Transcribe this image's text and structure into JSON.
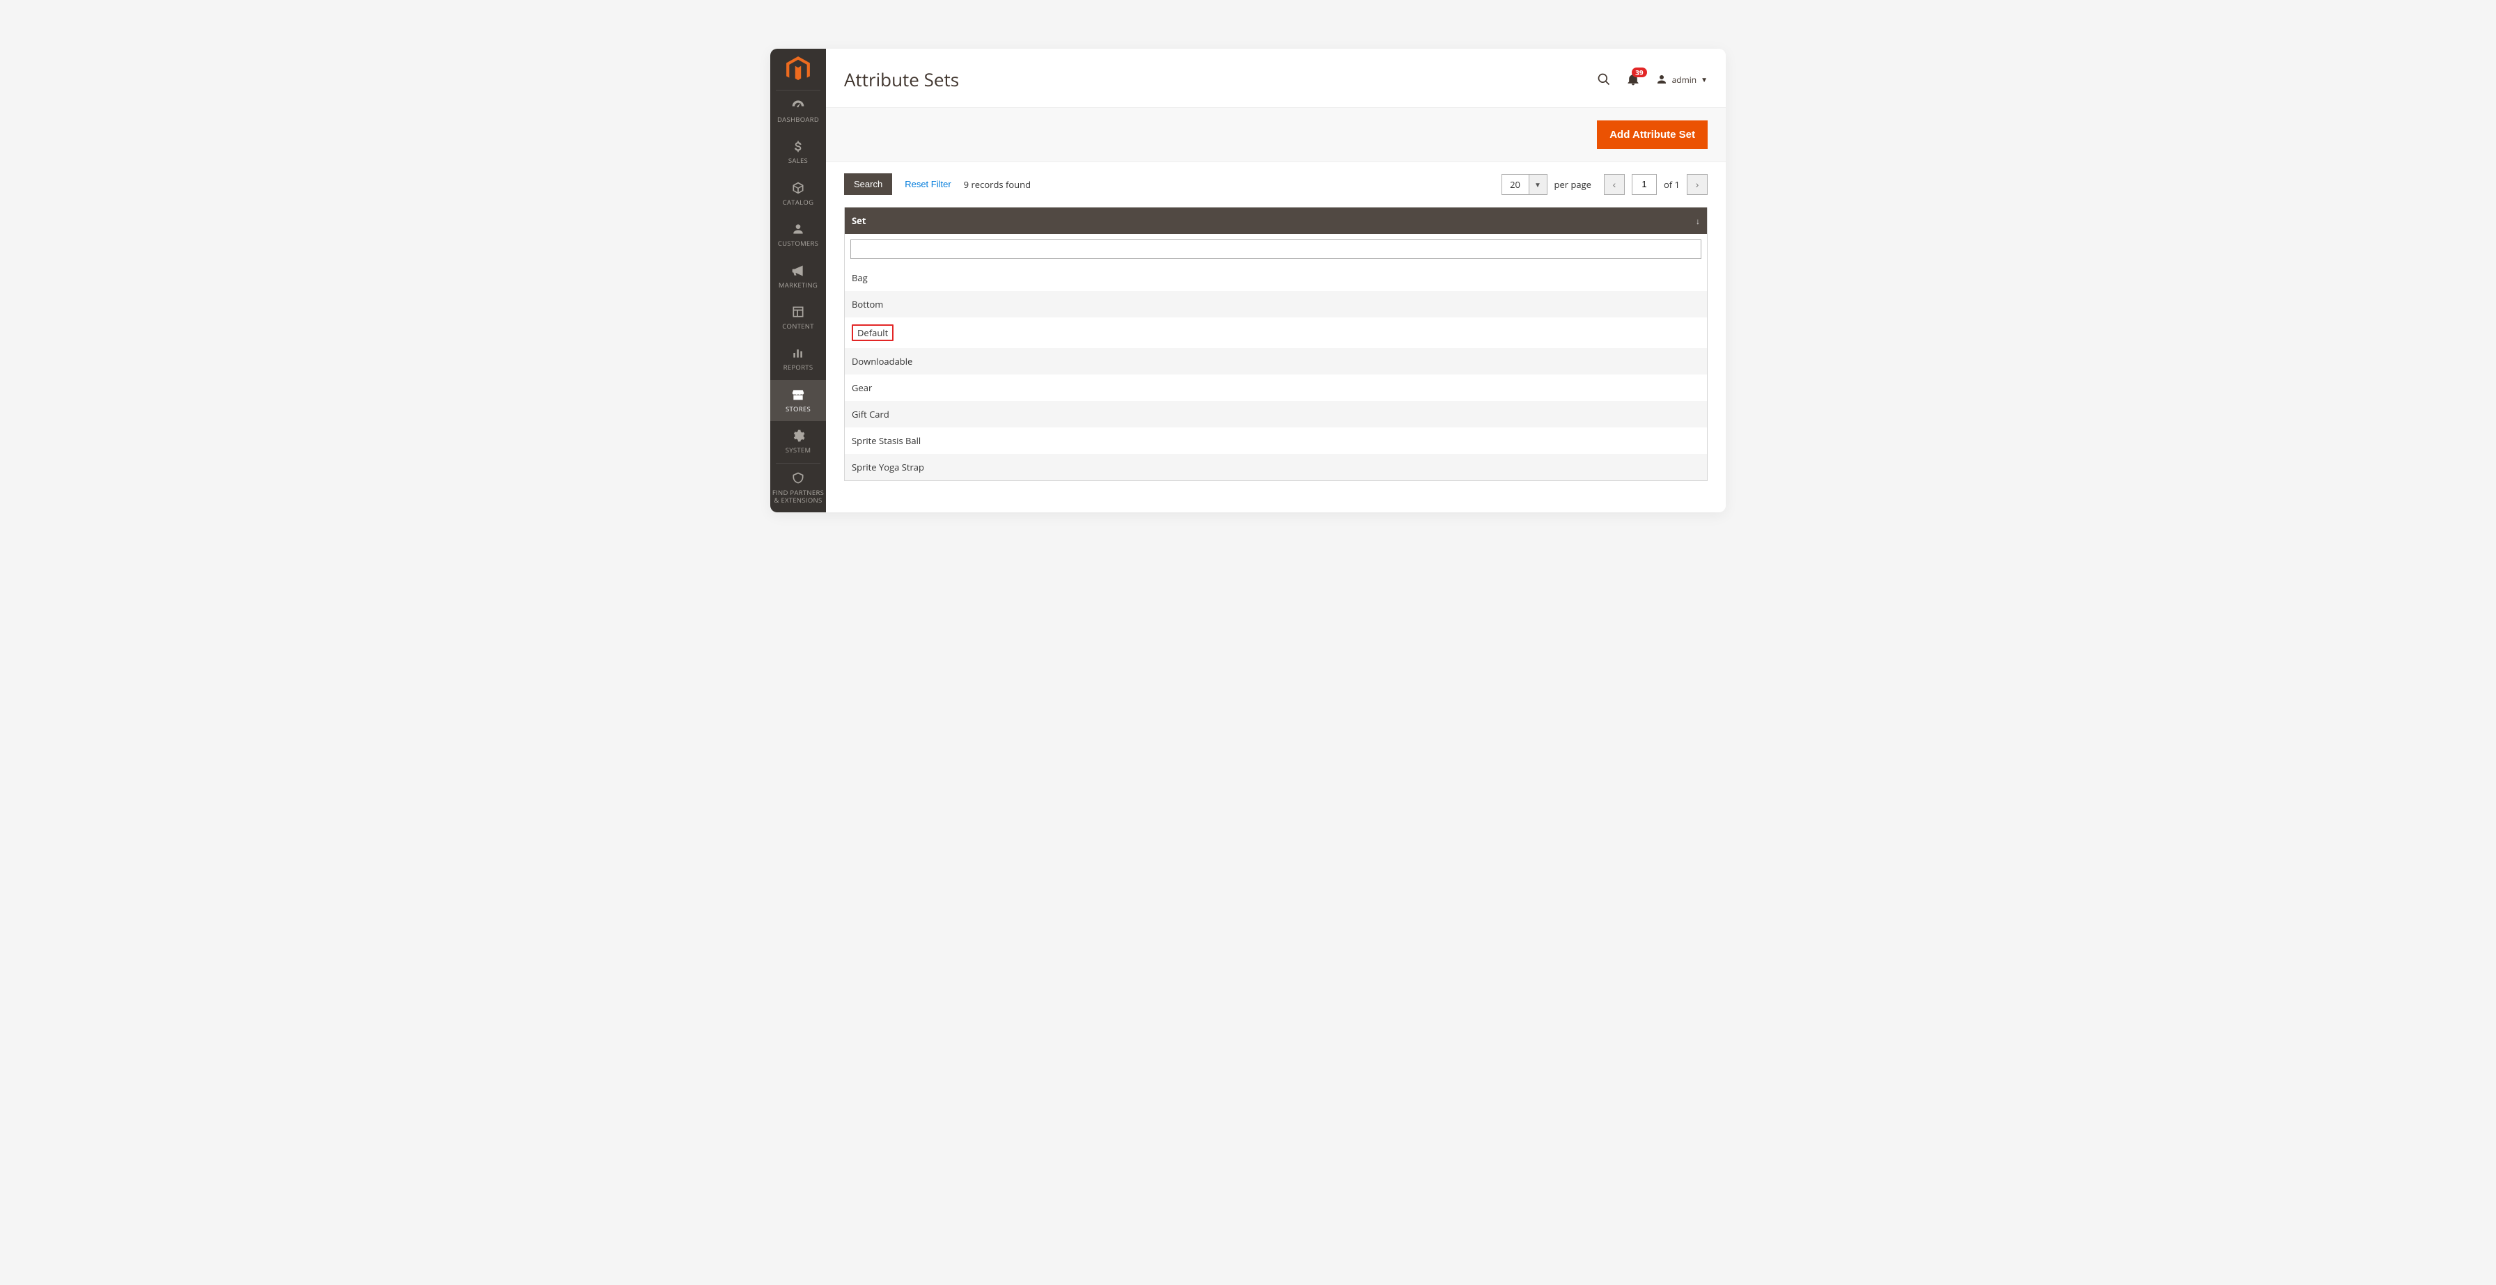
{
  "sidebar": {
    "items": [
      {
        "label": "DASHBOARD"
      },
      {
        "label": "SALES"
      },
      {
        "label": "CATALOG"
      },
      {
        "label": "CUSTOMERS"
      },
      {
        "label": "MARKETING"
      },
      {
        "label": "CONTENT"
      },
      {
        "label": "REPORTS"
      },
      {
        "label": "STORES"
      },
      {
        "label": "SYSTEM"
      },
      {
        "label": "FIND PARTNERS & EXTENSIONS"
      }
    ]
  },
  "header": {
    "page_title": "Attribute Sets",
    "notifications_count": "39",
    "username": "admin"
  },
  "action_bar": {
    "add_button": "Add Attribute Set"
  },
  "toolbar": {
    "search_label": "Search",
    "reset_label": "Reset Filter",
    "records_found": "9 records found",
    "per_page_value": "20",
    "per_page_label": "per page",
    "page_value": "1",
    "page_of_label": "of 1"
  },
  "grid": {
    "header_col": "Set",
    "filter_placeholder": "",
    "rows": [
      "Bag",
      "Bottom",
      "Default",
      "Downloadable",
      "Gear",
      "Gift Card",
      "Sprite Stasis Ball",
      "Sprite Yoga Strap"
    ],
    "highlight_index": 2
  }
}
